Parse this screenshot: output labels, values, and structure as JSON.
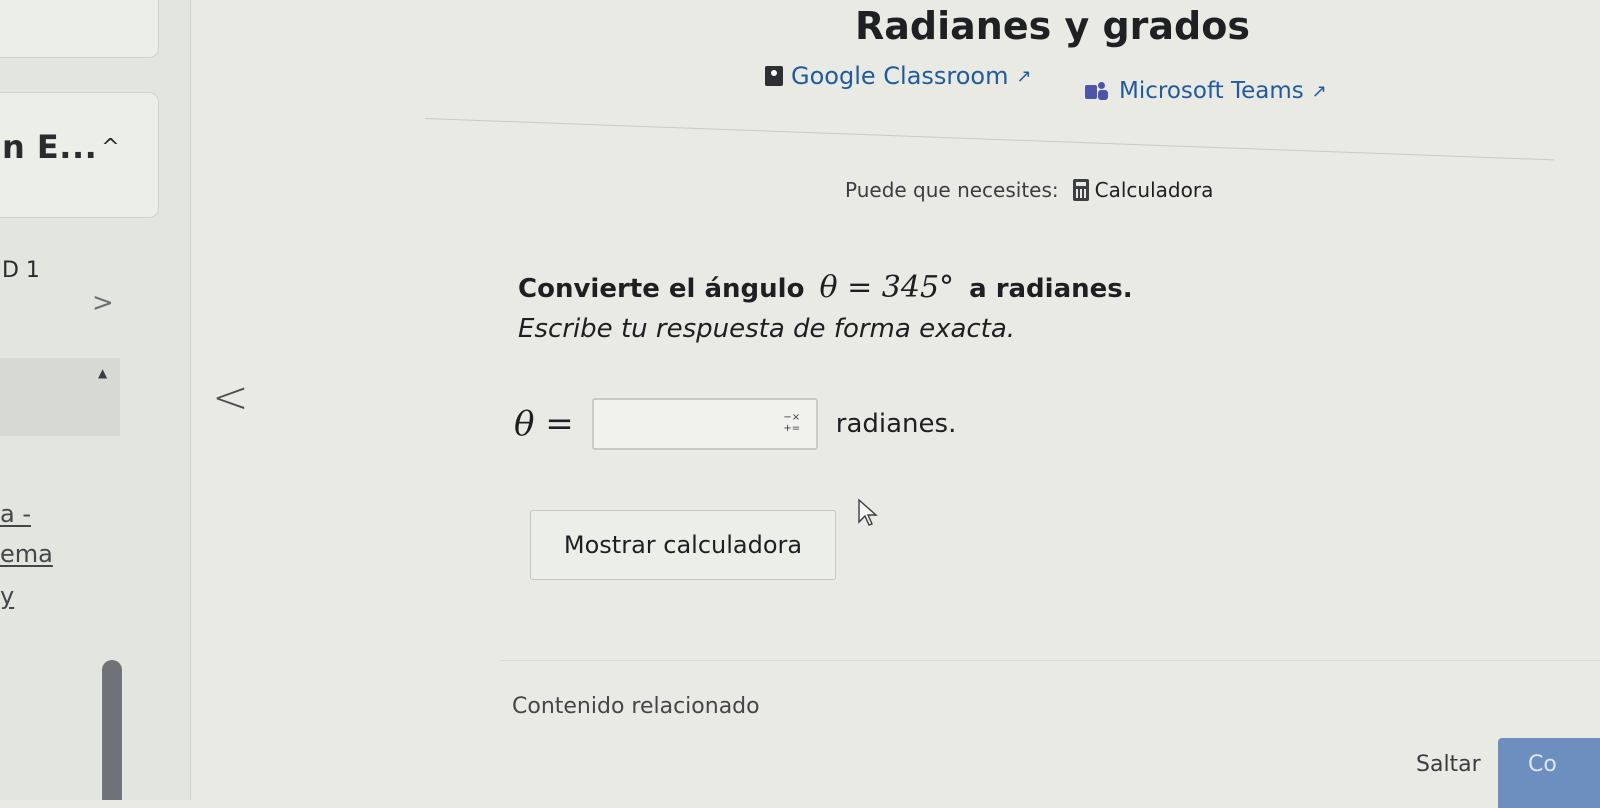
{
  "sidebar": {
    "heading": "n E...",
    "heading_caret": "^",
    "item_d1": "D 1",
    "item_chevron": ">",
    "panel_caret": "▲",
    "links": [
      "a -",
      "ema",
      "y"
    ]
  },
  "header": {
    "title": "Radianes y grados",
    "share": {
      "google_classroom": "Google Classroom",
      "microsoft_teams": "Microsoft Teams",
      "external_icon": "↗"
    }
  },
  "tools": {
    "needs_label": "Puede que necesites:",
    "calculator_link": "Calculadora"
  },
  "exercise": {
    "prompt_before": "Convierte el ángulo",
    "prompt_math": "θ = 345°",
    "prompt_after": "a radianes.",
    "instruction": "Escribe tu respuesta de forma exacta.",
    "answer_lhs": "θ =",
    "answer_value": "",
    "unit": "radianes.",
    "show_calculator": "Mostrar calculadora",
    "nav_prev": "<"
  },
  "footer": {
    "related": "Contenido relacionado",
    "skip": "Saltar",
    "check": "Co"
  }
}
